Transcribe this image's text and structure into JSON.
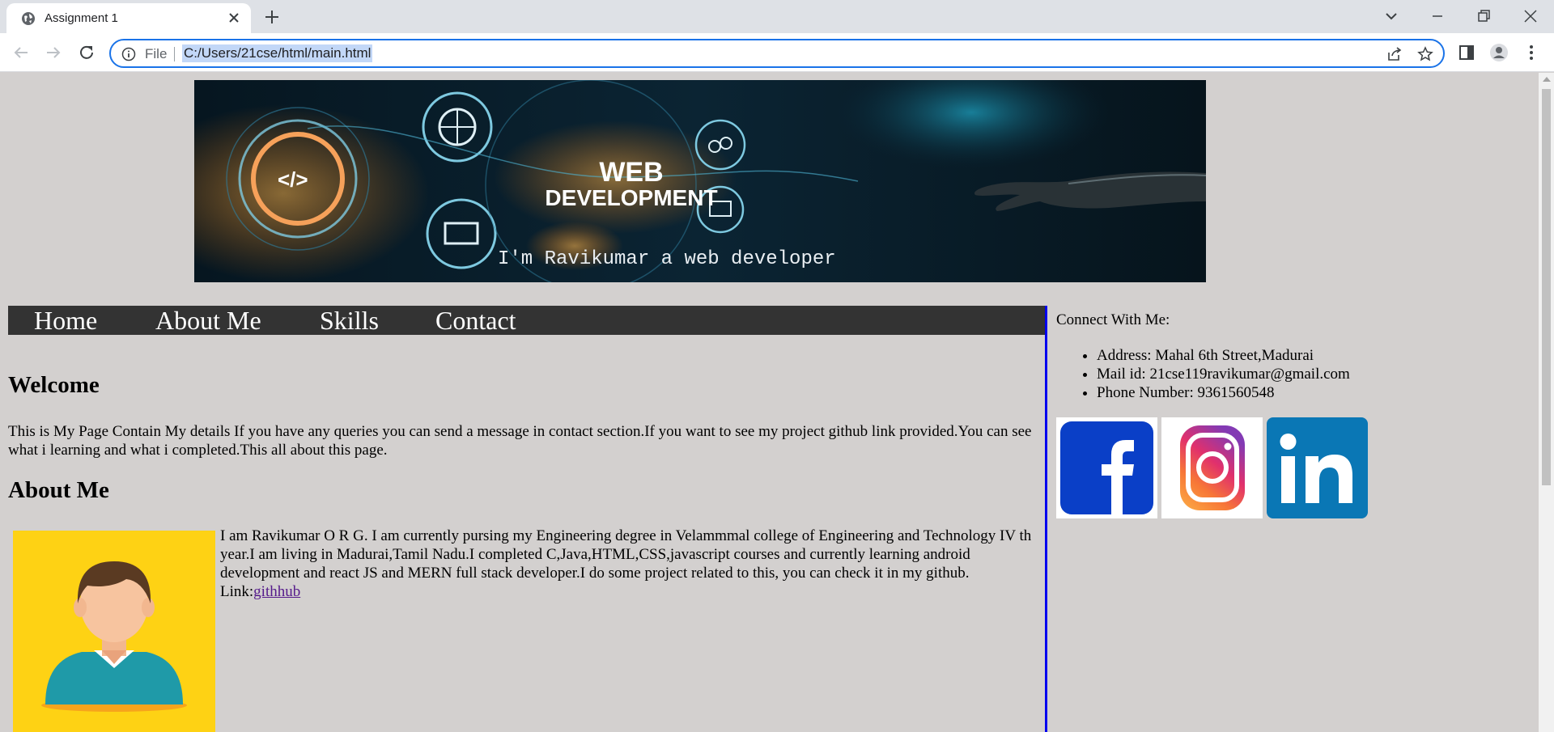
{
  "browser": {
    "tab_title": "Assignment 1",
    "address_scheme_label": "File",
    "url": "C:/Users/21cse/html/main.html"
  },
  "banner": {
    "caption": "I'm Ravikumar a web developer",
    "title_line1": "WEB",
    "title_line2": "DEVELOPMENT"
  },
  "nav": {
    "items": [
      {
        "label": "Home"
      },
      {
        "label": "About Me"
      },
      {
        "label": "Skills"
      },
      {
        "label": "Contact"
      }
    ]
  },
  "welcome": {
    "heading": "Welcome",
    "text": "This is My Page Contain My details If you have any queries you can send a message in contact section.If you want to see my project github link provided.You can see what i learning and what i completed.This all about this page."
  },
  "about": {
    "heading": "About Me",
    "text": "I am Ravikumar O R G. I am currently pursing my Engineering degree in Velammmal college of Engineering and Technology IV th year.I am living in Madurai,Tamil Nadu.I completed C,Java,HTML,CSS,javascript courses and currently learning android development and react JS and MERN full stack developer.I do some project related to this, you can check it in my github.",
    "link_prefix": "Link:",
    "link_text": "githhub"
  },
  "contact": {
    "heading": "Connect With Me:",
    "items": [
      "Address: Mahal 6th Street,Madurai",
      "Mail id: 21cse119ravikumar@gmail.com",
      "Phone Number: 9361560548"
    ]
  },
  "social_icons": [
    "facebook-icon",
    "instagram-icon",
    "linkedin-icon"
  ],
  "colors": {
    "page_bg": "#d3d0cf",
    "menu_bg": "#333333",
    "divider": "#0000ee",
    "facebook": "#0a3fc7",
    "linkedin": "#0a77b5"
  }
}
